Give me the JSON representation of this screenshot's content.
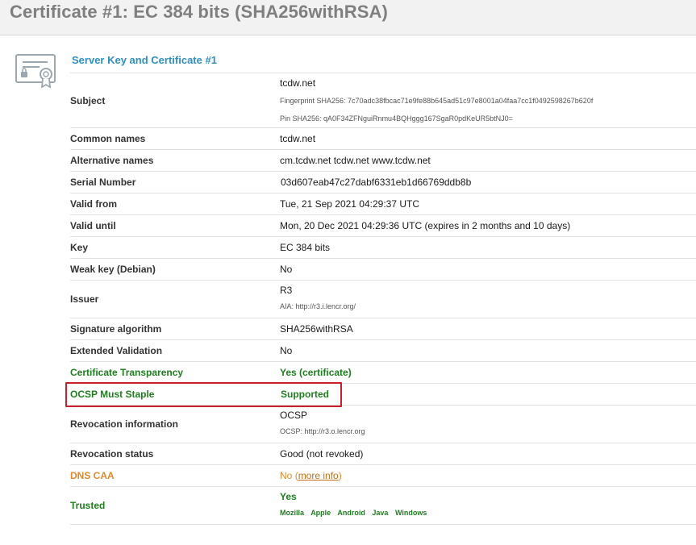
{
  "page": {
    "title": "Certificate #1: EC 384 bits (SHA256withRSA)"
  },
  "section": {
    "title": "Server Key and Certificate #1",
    "icon": "certificate-icon"
  },
  "rows": {
    "subject": {
      "label": "Subject",
      "value": "tcdw.net",
      "fingerprint": "Fingerprint SHA256: 7c70adc38fbcac71e9fe88b645ad51c97e8001a04faa7cc1f0492598267b620f",
      "pin": "Pin SHA256: qA0F34ZFNguiRnmu4BQHggg167SgaR0pdKeUR5btNJ0="
    },
    "common_names": {
      "label": "Common names",
      "value": "tcdw.net"
    },
    "alt_names": {
      "label": "Alternative names",
      "value": "cm.tcdw.net tcdw.net www.tcdw.net"
    },
    "serial": {
      "label": "Serial Number",
      "value": "03d607eab47c27dabf6331eb1d66769ddb8b"
    },
    "valid_from": {
      "label": "Valid from",
      "value": "Tue, 21 Sep 2021 04:29:37 UTC"
    },
    "valid_until": {
      "label": "Valid until",
      "value": "Mon, 20 Dec 2021 04:29:36 UTC (expires in 2 months and 10 days)"
    },
    "key": {
      "label": "Key",
      "value": "EC 384 bits"
    },
    "weak_key": {
      "label": "Weak key (Debian)",
      "value": "No"
    },
    "issuer": {
      "label": "Issuer",
      "value": "R3",
      "aia": "AIA: http://r3.i.lencr.org/"
    },
    "sig_alg": {
      "label": "Signature algorithm",
      "value": "SHA256withRSA"
    },
    "ev": {
      "label": "Extended Validation",
      "value": "No"
    },
    "ct": {
      "label": "Certificate Transparency",
      "value": "Yes (certificate)"
    },
    "ocsp_staple": {
      "label": "OCSP Must Staple",
      "value": "Supported"
    },
    "revocation_info": {
      "label": "Revocation information",
      "value": "OCSP",
      "ocsp": "OCSP: http://r3.o.lencr.org"
    },
    "revocation_status": {
      "label": "Revocation status",
      "value": "Good (not revoked)"
    },
    "dns_caa": {
      "label": "DNS CAA",
      "value": "No",
      "link": "more info"
    },
    "trusted": {
      "label": "Trusted",
      "value": "Yes",
      "stores": [
        "Mozilla",
        "Apple",
        "Android",
        "Java",
        "Windows"
      ]
    }
  },
  "colors": {
    "accent_blue": "#2f8fbf",
    "ok_green": "#1e7f1e",
    "warn_orange": "#e08a2e",
    "highlight_red": "#c8202a"
  }
}
